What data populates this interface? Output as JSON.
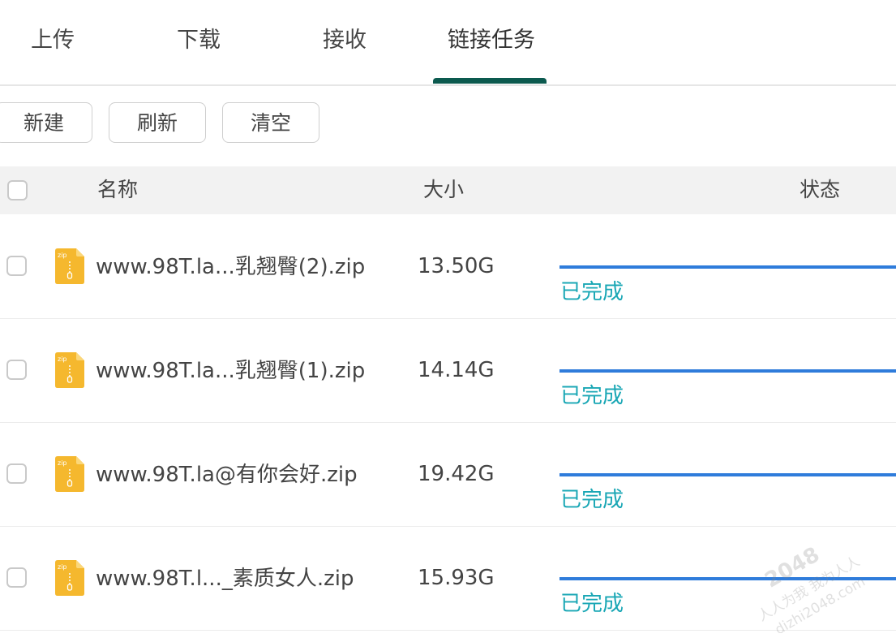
{
  "tabs": [
    {
      "label": "上传"
    },
    {
      "label": "下载"
    },
    {
      "label": "接收"
    },
    {
      "label": "链接任务",
      "active": true
    }
  ],
  "toolbar": {
    "new_label": "新建",
    "refresh_label": "刷新",
    "clear_label": "清空"
  },
  "table": {
    "headers": {
      "name": "名称",
      "size": "大小",
      "status": "状态"
    },
    "rows": [
      {
        "name": "www.98T.la...乳翘臀(2).zip",
        "size": "13.50G",
        "status": "已完成",
        "progress": 1.0,
        "icon": "zip-file-icon"
      },
      {
        "name": "www.98T.la...乳翘臀(1).zip",
        "size": "14.14G",
        "status": "已完成",
        "progress": 1.0,
        "icon": "zip-file-icon"
      },
      {
        "name": "www.98T.la@有你会好.zip",
        "size": "19.42G",
        "status": "已完成",
        "progress": 1.0,
        "icon": "zip-file-icon"
      },
      {
        "name": "www.98T.l..._素质女人.zip",
        "size": "15.93G",
        "status": "已完成",
        "progress": 1.0,
        "icon": "zip-file-icon"
      }
    ]
  },
  "colors": {
    "tab_indicator": "#0c5a4f",
    "progress": "#2f7cdb",
    "status_done": "#1aa7b5",
    "zip_icon": "#f5b82e"
  },
  "watermark": {
    "line1": "2048",
    "line2": "人人为我 我为人人",
    "line3": "dizhi2048.com"
  }
}
